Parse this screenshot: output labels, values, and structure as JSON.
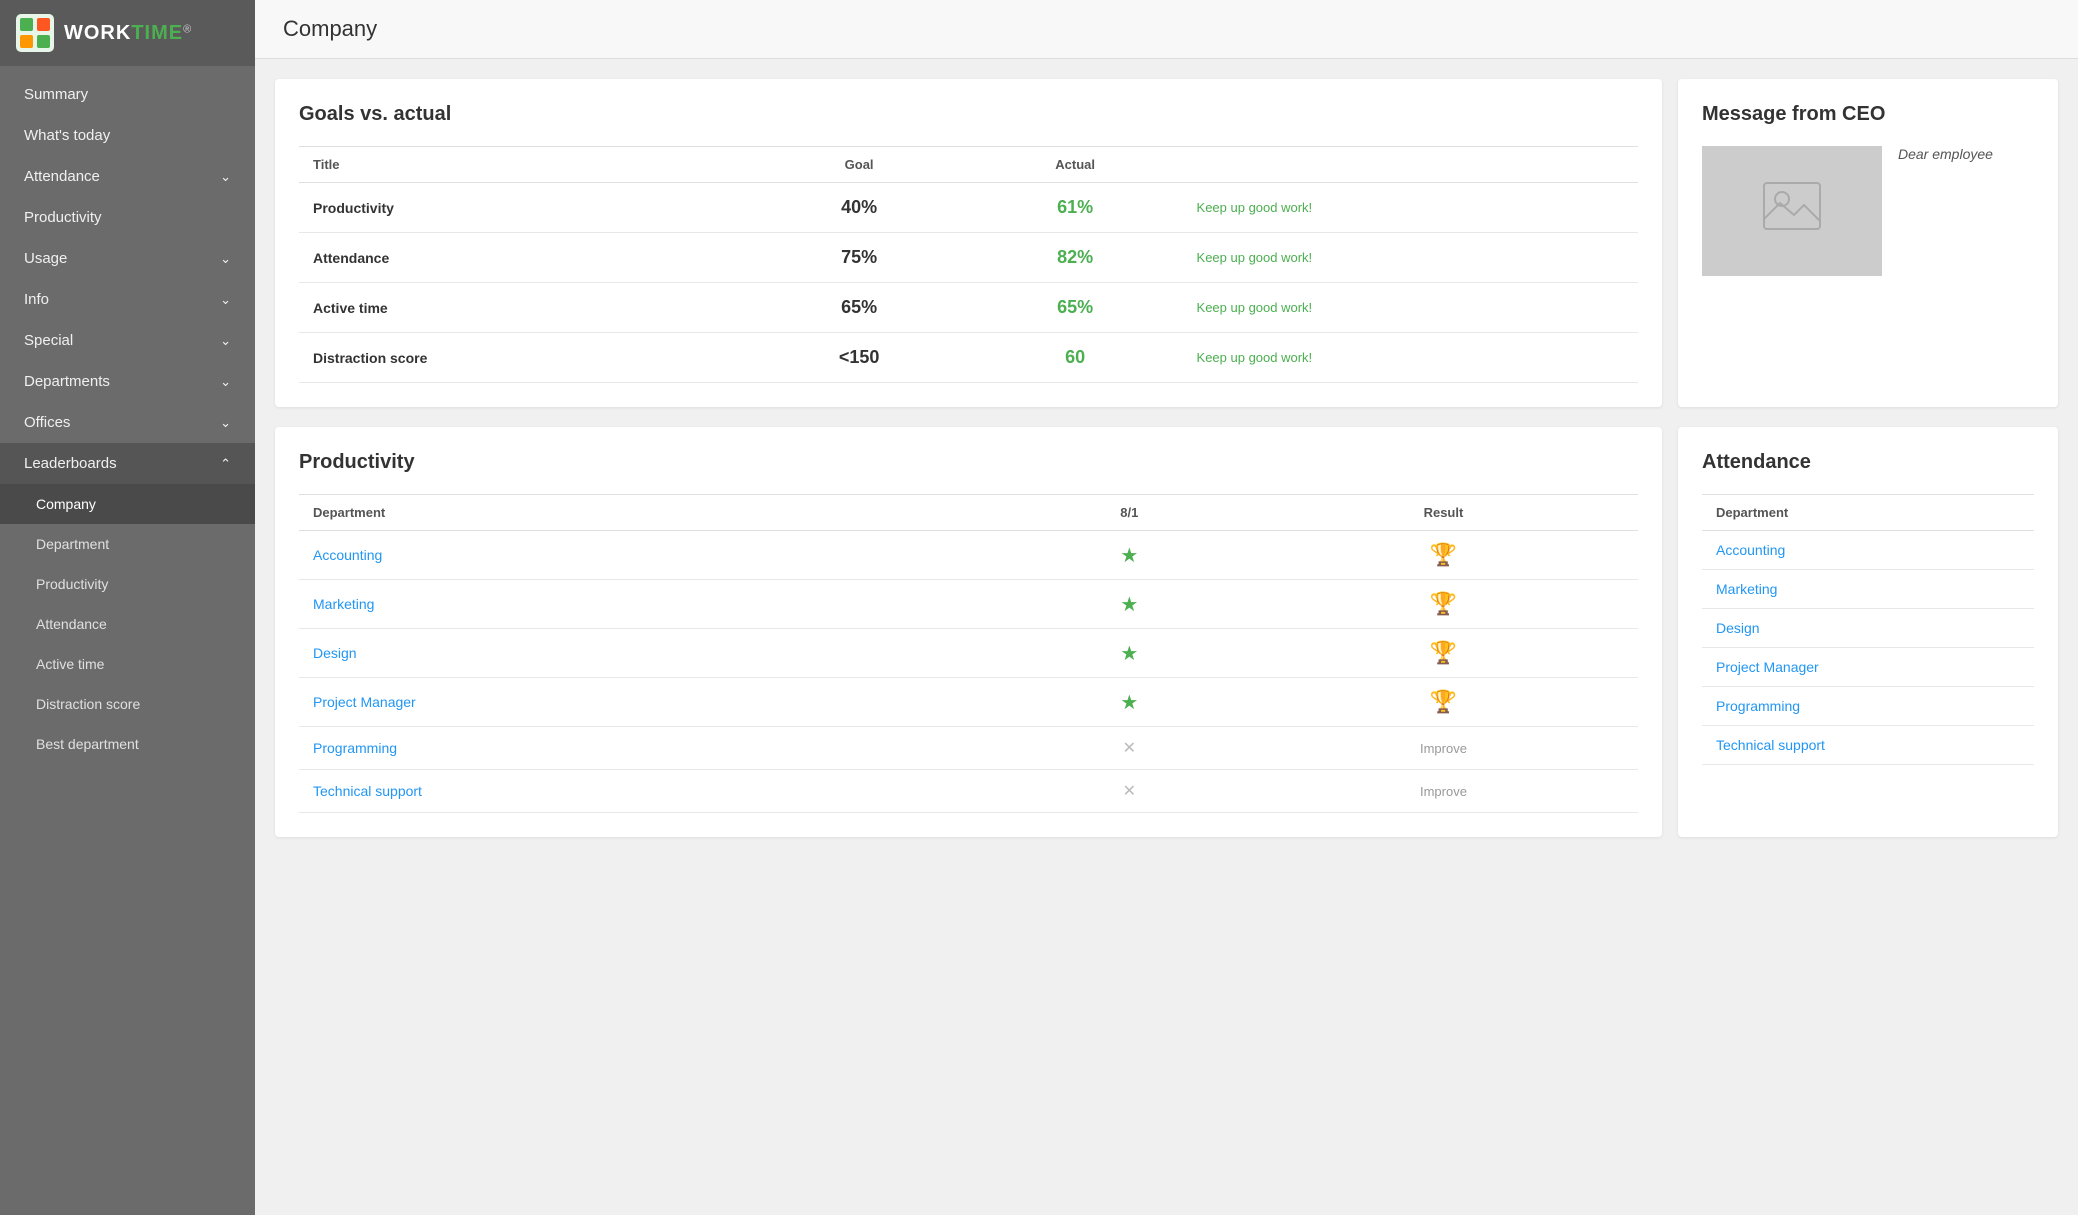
{
  "app": {
    "name": "WORKTIME",
    "trademark": "®"
  },
  "page": {
    "title": "Company"
  },
  "sidebar": {
    "items": [
      {
        "id": "summary",
        "label": "Summary",
        "hasChevron": false,
        "active": false
      },
      {
        "id": "whats-today",
        "label": "What's today",
        "hasChevron": false,
        "active": false
      },
      {
        "id": "attendance",
        "label": "Attendance",
        "hasChevron": true,
        "active": false
      },
      {
        "id": "productivity",
        "label": "Productivity",
        "hasChevron": false,
        "active": false
      },
      {
        "id": "usage",
        "label": "Usage",
        "hasChevron": true,
        "active": false
      },
      {
        "id": "info",
        "label": "Info",
        "hasChevron": true,
        "active": false
      },
      {
        "id": "special",
        "label": "Special",
        "hasChevron": true,
        "active": false
      },
      {
        "id": "departments",
        "label": "Departments",
        "hasChevron": true,
        "active": false
      },
      {
        "id": "offices",
        "label": "Offices",
        "hasChevron": true,
        "active": false
      },
      {
        "id": "leaderboards",
        "label": "Leaderboards",
        "hasChevron": true,
        "active": true,
        "expanded": true
      }
    ],
    "subitems": [
      {
        "id": "company",
        "label": "Company",
        "active": true
      },
      {
        "id": "department",
        "label": "Department",
        "active": false
      },
      {
        "id": "sub-productivity",
        "label": "Productivity",
        "active": false
      },
      {
        "id": "sub-attendance",
        "label": "Attendance",
        "active": false
      },
      {
        "id": "sub-active-time",
        "label": "Active time",
        "active": false
      },
      {
        "id": "sub-distraction-score",
        "label": "Distraction score",
        "active": false
      },
      {
        "id": "best-department",
        "label": "Best department",
        "active": false
      }
    ]
  },
  "goals": {
    "section_title": "Goals vs. actual",
    "columns": {
      "title": "Title",
      "goal": "Goal",
      "actual": "Actual"
    },
    "rows": [
      {
        "title": "Productivity",
        "goal": "40%",
        "actual": "61%",
        "status": "Keep up good work!"
      },
      {
        "title": "Attendance",
        "goal": "75%",
        "actual": "82%",
        "status": "Keep up good work!"
      },
      {
        "title": "Active time",
        "goal": "65%",
        "actual": "65%",
        "status": "Keep up good work!"
      },
      {
        "title": "Distraction score",
        "goal": "<150",
        "actual": "60",
        "status": "Keep up good work!"
      }
    ]
  },
  "ceo": {
    "section_title": "Message from CEO",
    "message": "Dear employee"
  },
  "productivity": {
    "section_title": "Productivity",
    "columns": {
      "department": "Department",
      "date": "8/1",
      "result": "Result"
    },
    "rows": [
      {
        "name": "Accounting",
        "hasstar": true,
        "hasTrophy": true,
        "improve": false
      },
      {
        "name": "Marketing",
        "hasstar": true,
        "hasTrophy": true,
        "improve": false
      },
      {
        "name": "Design",
        "hasstar": true,
        "hasTrophy": true,
        "improve": false
      },
      {
        "name": "Project Manager",
        "hasstar": true,
        "hasTrophy": true,
        "improve": false
      },
      {
        "name": "Programming",
        "hasstar": false,
        "hasTrophy": false,
        "improve": true
      },
      {
        "name": "Technical support",
        "hasstar": false,
        "hasTrophy": false,
        "improve": true
      }
    ]
  },
  "attendance": {
    "section_title": "Attendance",
    "columns": {
      "department": "Department"
    },
    "rows": [
      {
        "name": "Accounting"
      },
      {
        "name": "Marketing"
      },
      {
        "name": "Design"
      },
      {
        "name": "Project Manager"
      },
      {
        "name": "Programming"
      },
      {
        "name": "Technical support"
      }
    ]
  }
}
